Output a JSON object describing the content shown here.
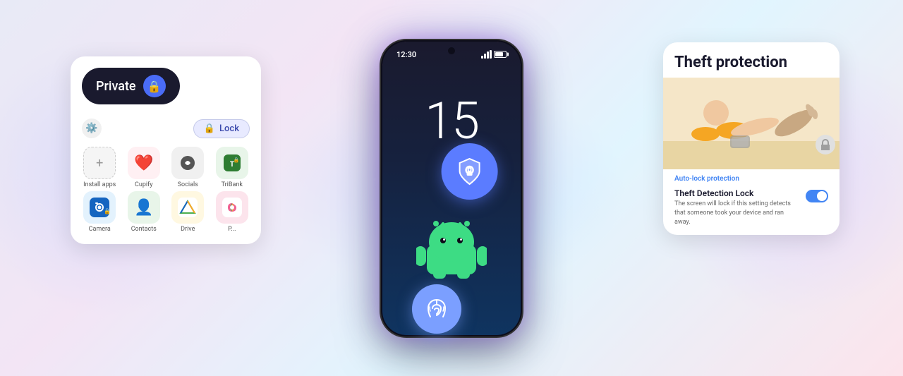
{
  "background": {
    "gradient": "linear-gradient(135deg, #e8eaf6 0%, #f3e5f5 30%, #e1f5fe 60%, #fce4ec 100%)"
  },
  "phone": {
    "time": "12:30",
    "clock": "15"
  },
  "private_card": {
    "label": "Private",
    "lock_btn": "Lock",
    "apps": [
      {
        "name": "Install apps",
        "type": "install"
      },
      {
        "name": "Cupify",
        "type": "cupify"
      },
      {
        "name": "Socials",
        "type": "socials"
      },
      {
        "name": "TriBank",
        "type": "tribank"
      },
      {
        "name": "Camera",
        "type": "camera"
      },
      {
        "name": "Contacts",
        "type": "contacts"
      },
      {
        "name": "Drive",
        "type": "drive"
      },
      {
        "name": "Photos",
        "type": "photos"
      }
    ]
  },
  "theft_card": {
    "title": "Theft protection",
    "auto_lock_label": "Auto-lock protection",
    "detection_title": "Theft Detection Lock",
    "detection_desc": "The screen will lock if this setting detects that someone took your device and ran away."
  }
}
